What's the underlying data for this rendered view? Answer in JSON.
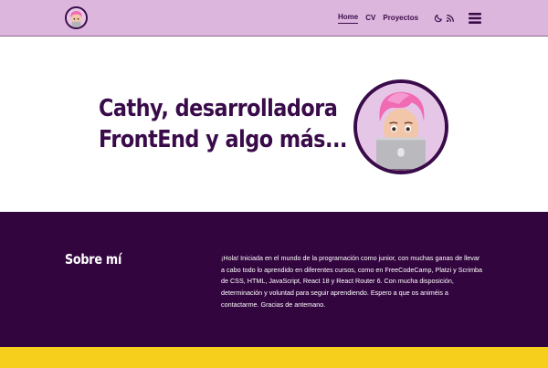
{
  "header": {
    "nav": [
      {
        "label": "Home",
        "active": true
      },
      {
        "label": "CV",
        "active": false
      },
      {
        "label": "Proyectos",
        "active": false
      }
    ],
    "icons": [
      "moon-icon",
      "rss-icon",
      "menu-icon"
    ],
    "background": "#ddb6dd"
  },
  "hero": {
    "title_line1": "Cathy, desarrolladora",
    "title_line2": "FrontEnd y algo más...",
    "title_color": "#3a0b4a"
  },
  "about": {
    "heading": "Sobre mí",
    "text": "¡Hola! Iniciada en el mundo de la programación como junior, con muchas ganas de llevar a cabo todo lo aprendido en diferentes cursos, como en FreeCodeCamp, Platzi y Scrimba de CSS, HTML, JavaScript, React 18 y React Router 6. Con mucha disposición, determinación y voluntad para seguir aprendiendo. Espero a que os animéis a contactarme. Gracias de antemano.",
    "background": "#33053f"
  },
  "footer": {
    "background": "#f5cf1b"
  }
}
